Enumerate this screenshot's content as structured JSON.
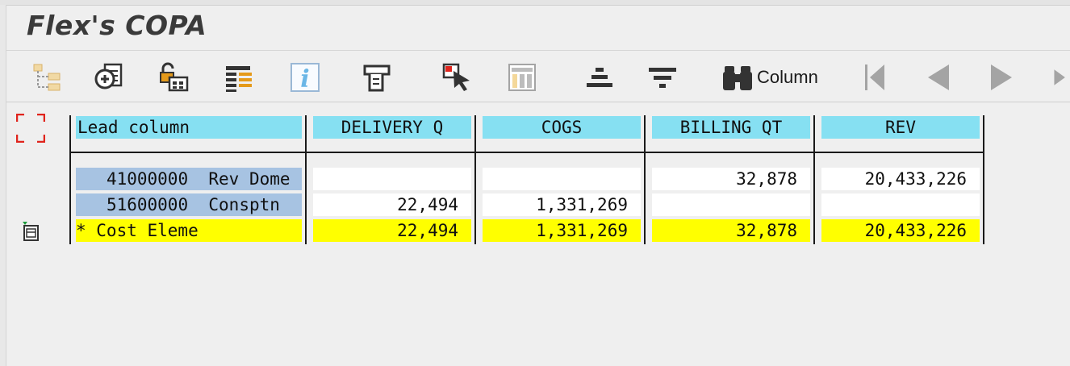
{
  "window": {
    "title": "Flex's COPA"
  },
  "toolbar": {
    "buttons": [
      {
        "icon": "hierarchy-icon"
      },
      {
        "icon": "settings-document-icon"
      },
      {
        "icon": "lock-settings-icon"
      },
      {
        "icon": "layout-list-icon"
      },
      {
        "icon": "info-icon"
      },
      {
        "icon": "print-icon"
      },
      {
        "icon": "select-pointer-icon"
      },
      {
        "icon": "column-layout-icon"
      },
      {
        "icon": "sort-ascending-icon"
      },
      {
        "icon": "filter-icon"
      },
      {
        "icon": "binoculars-icon",
        "label": "Column"
      },
      {
        "icon": "first-page-icon"
      },
      {
        "icon": "previous-icon"
      },
      {
        "icon": "next-icon"
      },
      {
        "icon": "last-page-icon"
      }
    ]
  },
  "report": {
    "headers": [
      "Lead column",
      "DELIVERY Q",
      "COGS",
      "BILLING QT",
      "REV"
    ],
    "rows": [
      {
        "code": "41000000",
        "name": "Rev Dome",
        "values": [
          "",
          "",
          "32,878",
          "20,433,226"
        ]
      },
      {
        "code": "51600000",
        "name": "Consptn",
        "values": [
          "22,494",
          "1,331,269",
          "",
          ""
        ]
      }
    ],
    "total": {
      "label": "* Cost Eleme",
      "values": [
        "22,494",
        "1,331,269",
        "32,878",
        "20,433,226"
      ]
    }
  },
  "colors": {
    "header": "#86e0f2",
    "lead": "#a7c3e2",
    "total": "#ffff00",
    "icon_disabled": "#9e9e9e"
  }
}
